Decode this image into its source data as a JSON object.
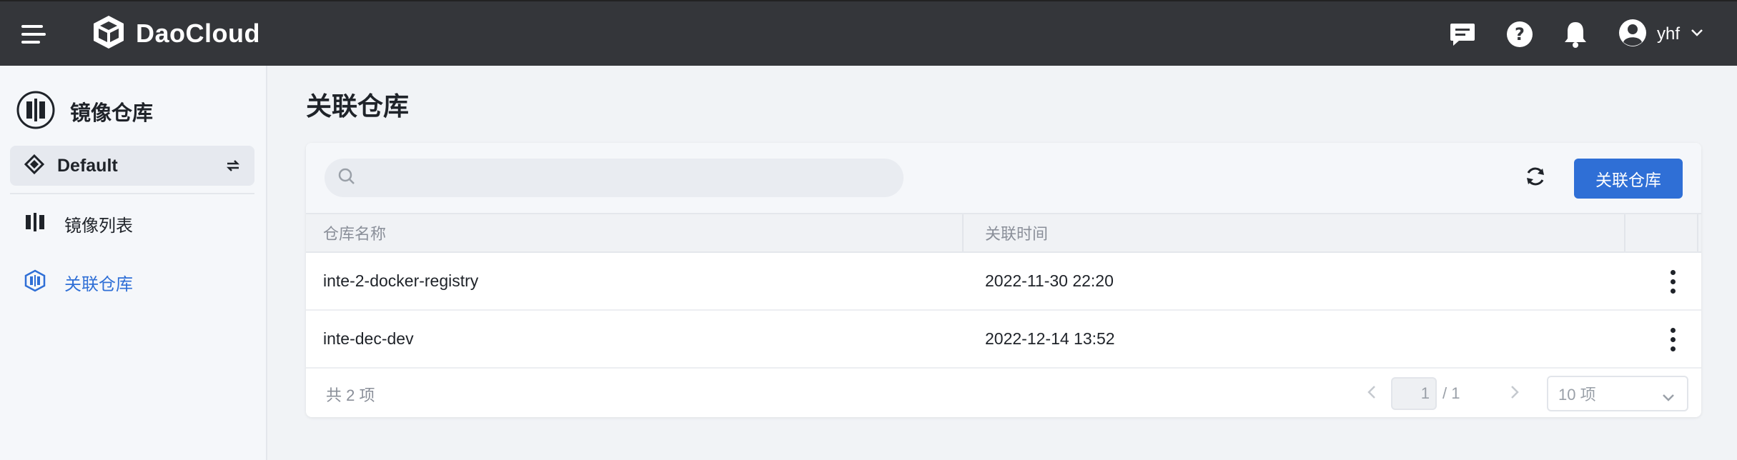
{
  "header": {
    "brand": "DaoCloud",
    "user_name": "yhf",
    "icons": [
      "menu-icon",
      "daocloud-logo-icon",
      "message-icon",
      "help-icon",
      "bell-icon",
      "user-avatar-icon",
      "chevron-down-icon"
    ]
  },
  "sidebar": {
    "module_title": "镜像仓库",
    "workspace": "Default",
    "items": [
      {
        "label": "镜像列表",
        "icon": "image-list-icon",
        "active": false
      },
      {
        "label": "关联仓库",
        "icon": "registry-icon",
        "active": true
      }
    ]
  },
  "main": {
    "page_title": "关联仓库",
    "search": {
      "placeholder": "",
      "value": ""
    },
    "associate_button": "关联仓库",
    "table": {
      "columns": [
        "仓库名称",
        "关联时间",
        ""
      ],
      "rows": [
        {
          "name": "inte-2-docker-registry",
          "time": "2022-11-30 22:20"
        },
        {
          "name": "inte-dec-dev",
          "time": "2022-12-14 13:52"
        }
      ]
    },
    "pagination": {
      "total_text": "共 2 项",
      "current_page": "1",
      "of_pages": "/ 1",
      "page_size": "10 项"
    }
  },
  "colors": {
    "topbar": "#34363a",
    "primary": "#2f6fd6",
    "sidebar_bg": "#f5f7fa",
    "page_bg": "#f1f3f6"
  }
}
